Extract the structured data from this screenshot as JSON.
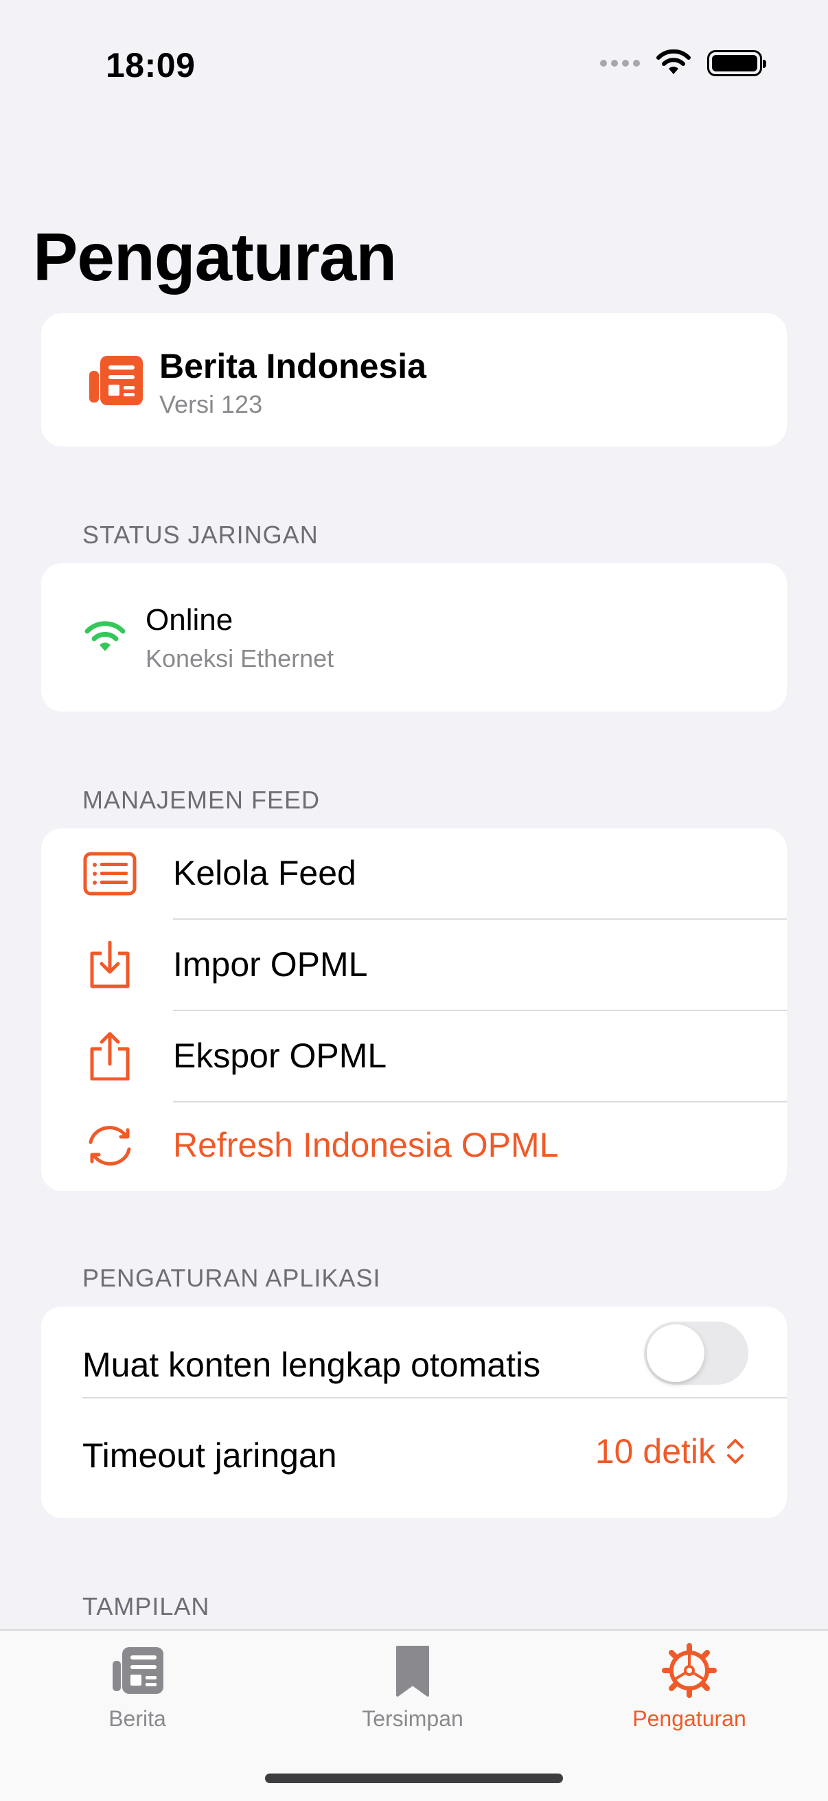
{
  "status_bar": {
    "time": "18:09"
  },
  "page_title": "Pengaturan",
  "app_info": {
    "name": "Berita Indonesia",
    "version": "Versi 123"
  },
  "network": {
    "header": "STATUS JARINGAN",
    "status": "Online",
    "detail": "Koneksi Ethernet",
    "status_color": "#34c759"
  },
  "feed_management": {
    "header": "MANAJEMEN FEED",
    "items": [
      {
        "label": "Kelola Feed",
        "icon": "list-icon"
      },
      {
        "label": "Impor OPML",
        "icon": "import-icon"
      },
      {
        "label": "Ekspor OPML",
        "icon": "share-icon"
      },
      {
        "label": "Refresh Indonesia OPML",
        "icon": "refresh-icon"
      }
    ]
  },
  "app_settings": {
    "header": "PENGATURAN APLIKASI",
    "auto_full_content_label": "Muat konten lengkap otomatis",
    "auto_full_content_enabled": false,
    "timeout_label": "Timeout jaringan",
    "timeout_value": "10 detik"
  },
  "display": {
    "header": "TAMPILAN"
  },
  "tabbar": {
    "tabs": [
      {
        "label": "Berita",
        "icon": "newspaper-icon",
        "active": false
      },
      {
        "label": "Tersimpan",
        "icon": "bookmark-icon",
        "active": false
      },
      {
        "label": "Pengaturan",
        "icon": "gear-icon",
        "active": true
      }
    ]
  },
  "colors": {
    "accent": "#f05a28",
    "background": "#f2f2f7"
  }
}
